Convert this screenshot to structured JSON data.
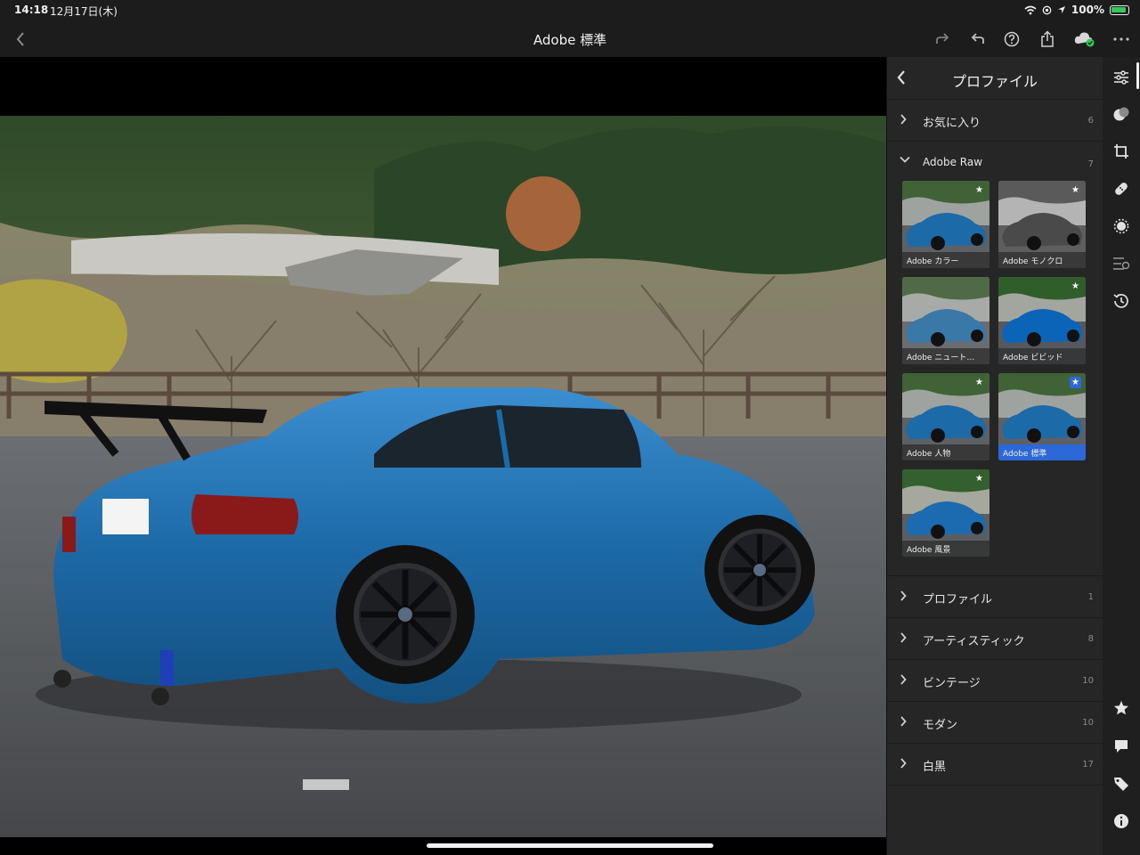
{
  "status": {
    "time": "14:18",
    "date": "12月17日(木)",
    "battery": "100%"
  },
  "nav": {
    "title": "Adobe 標準"
  },
  "panel": {
    "title": "プロファイル",
    "favorites": {
      "label": "お気に入り",
      "count": "6"
    },
    "adobe_raw": {
      "label": "Adobe Raw",
      "count": "7"
    },
    "thumbs": [
      {
        "label": "Adobe カラー",
        "tone": "color",
        "starred": true,
        "selected": false
      },
      {
        "label": "Adobe モノクロ",
        "tone": "mono",
        "starred": true,
        "selected": false
      },
      {
        "label": "Adobe ニュート…",
        "tone": "neutral",
        "starred": false,
        "selected": false
      },
      {
        "label": "Adobe ビビッド",
        "tone": "vivid",
        "starred": true,
        "selected": false
      },
      {
        "label": "Adobe 人物",
        "tone": "color",
        "starred": true,
        "selected": false
      },
      {
        "label": "Adobe 標準",
        "tone": "color",
        "starred": true,
        "selected": true
      },
      {
        "label": "Adobe 風景",
        "tone": "landscape",
        "starred": true,
        "selected": false
      }
    ],
    "groups": [
      {
        "label": "プロファイル",
        "count": "1"
      },
      {
        "label": "アーティスティック",
        "count": "8"
      },
      {
        "label": "ビンテージ",
        "count": "10"
      },
      {
        "label": "モダン",
        "count": "10"
      },
      {
        "label": "白黒",
        "count": "17"
      }
    ]
  },
  "toolbar": {
    "top": [
      "sliders-icon",
      "color-mix-icon",
      "crop-icon",
      "healing-icon",
      "mask-icon",
      "presets-icon",
      "history-icon"
    ],
    "bottom": [
      "star-icon",
      "comment-icon",
      "tag-icon",
      "info-icon"
    ]
  },
  "colors": {
    "accent": "#2c68d8",
    "panel": "#262626",
    "car": "#1d6aa8"
  }
}
